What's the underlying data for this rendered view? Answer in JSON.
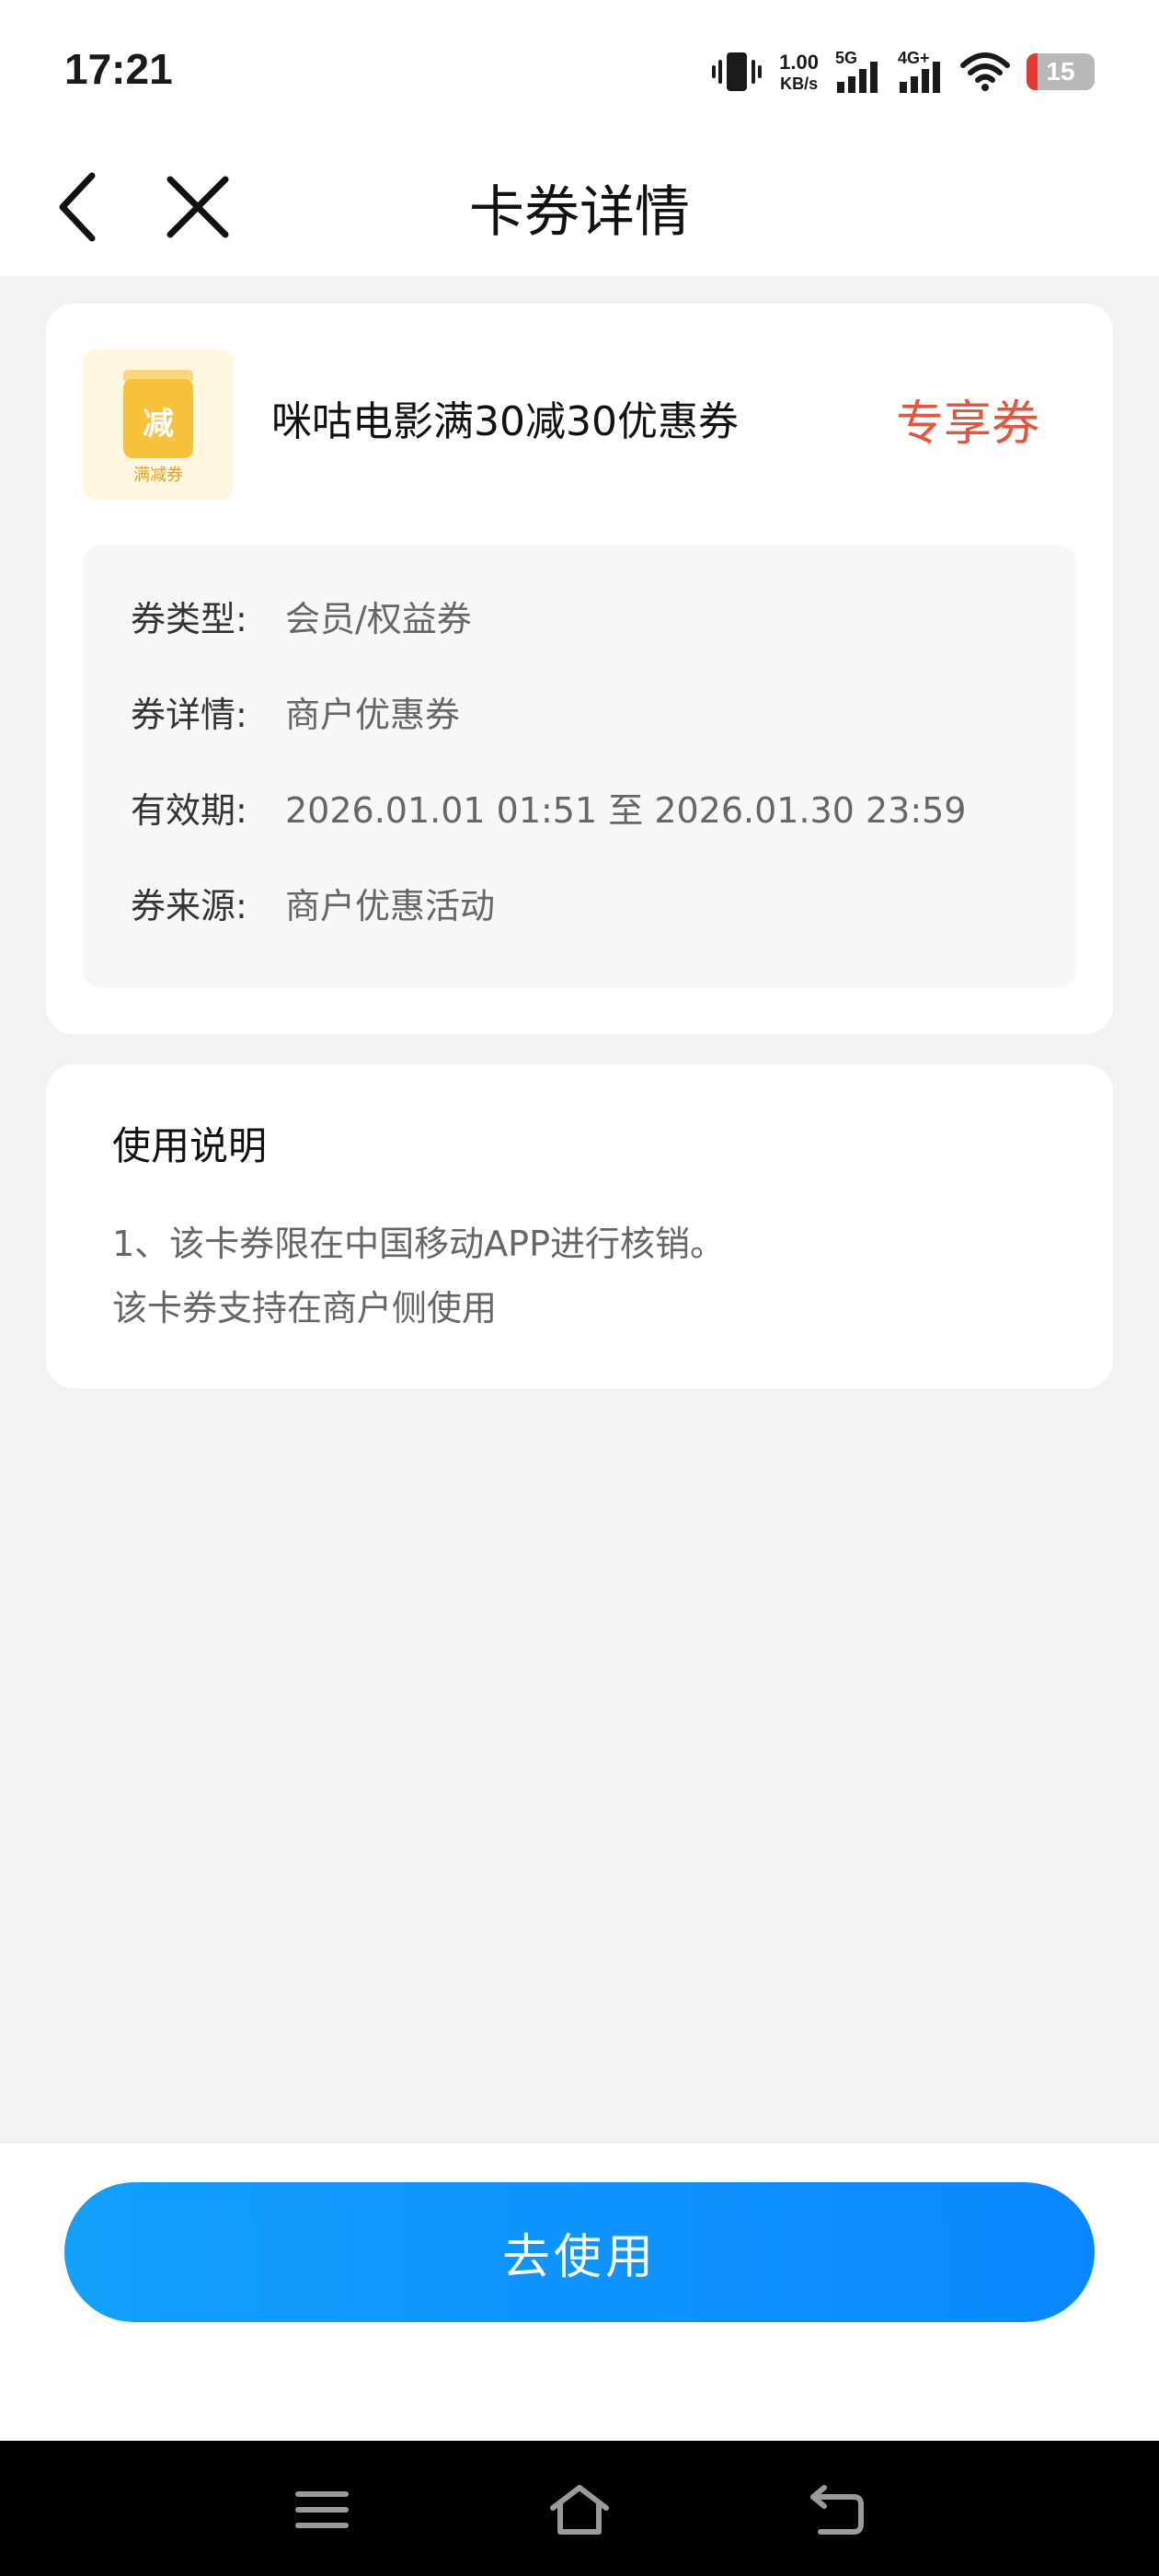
{
  "status_bar": {
    "time": "17:21",
    "net_speed_value": "1.00",
    "net_speed_unit": "KB/s",
    "sim1_tag": "5G",
    "sim2_tag": "4G+",
    "battery_level": "15"
  },
  "nav": {
    "title": "卡券详情",
    "back_icon": "chevron-left-icon",
    "close_icon": "close-icon"
  },
  "coupon": {
    "icon_char": "减",
    "icon_caption": "满减券",
    "name": "咪咕电影满30减30优惠券",
    "tag": "专享券",
    "info": [
      {
        "label": "券类型:",
        "value": "会员/权益券"
      },
      {
        "label": "券详情:",
        "value": "商户优惠券"
      },
      {
        "label": "有效期:",
        "value": "2026.01.01 01:51 至 2026.01.30 23:59"
      },
      {
        "label": "券来源:",
        "value": "商户优惠活动"
      }
    ]
  },
  "usage": {
    "title": "使用说明",
    "lines": [
      "1、该卡券限在中国移动APP进行核销。",
      "该卡券支持在商户侧使用"
    ]
  },
  "action": {
    "use_label": "去使用"
  },
  "colors": {
    "accent_red": "#e8533b",
    "button_blue_start": "#12a0fb",
    "button_blue_end": "#0a87ff",
    "icon_yellow": "#f7c23a"
  }
}
